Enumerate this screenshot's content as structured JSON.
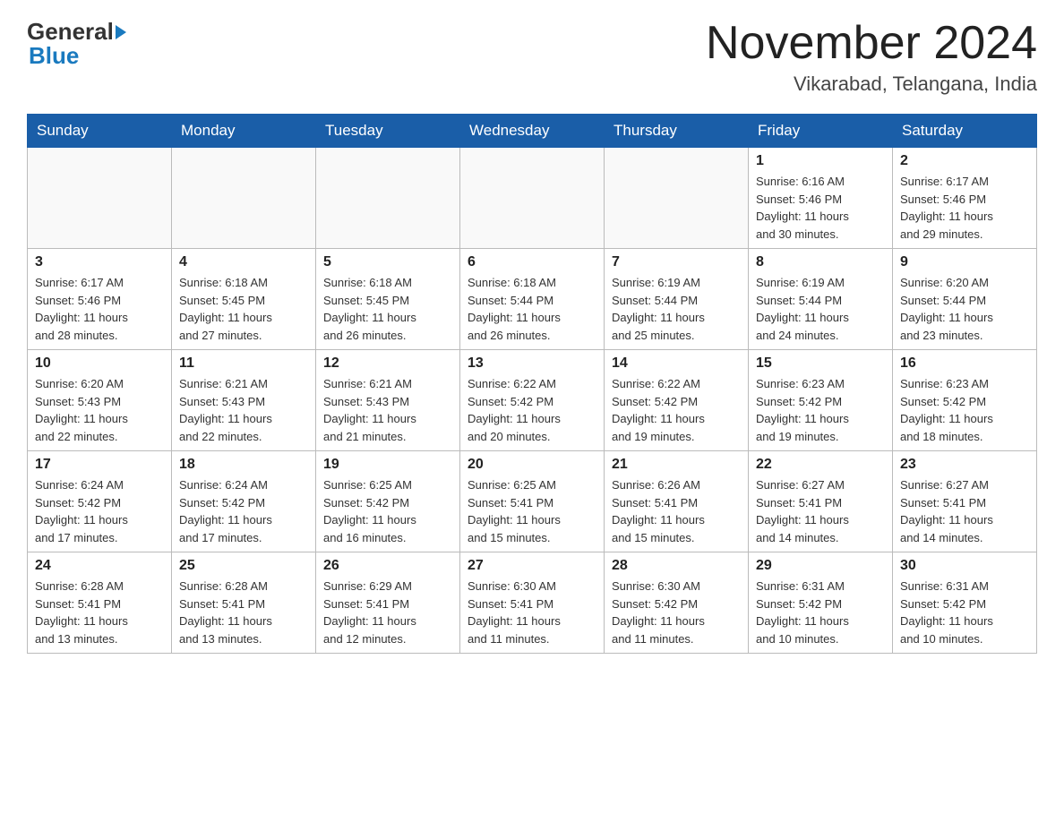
{
  "header": {
    "logo_general": "General",
    "logo_blue": "Blue",
    "month_title": "November 2024",
    "location": "Vikarabad, Telangana, India"
  },
  "weekdays": [
    "Sunday",
    "Monday",
    "Tuesday",
    "Wednesday",
    "Thursday",
    "Friday",
    "Saturday"
  ],
  "weeks": [
    [
      {
        "day": "",
        "info": ""
      },
      {
        "day": "",
        "info": ""
      },
      {
        "day": "",
        "info": ""
      },
      {
        "day": "",
        "info": ""
      },
      {
        "day": "",
        "info": ""
      },
      {
        "day": "1",
        "info": "Sunrise: 6:16 AM\nSunset: 5:46 PM\nDaylight: 11 hours\nand 30 minutes."
      },
      {
        "day": "2",
        "info": "Sunrise: 6:17 AM\nSunset: 5:46 PM\nDaylight: 11 hours\nand 29 minutes."
      }
    ],
    [
      {
        "day": "3",
        "info": "Sunrise: 6:17 AM\nSunset: 5:46 PM\nDaylight: 11 hours\nand 28 minutes."
      },
      {
        "day": "4",
        "info": "Sunrise: 6:18 AM\nSunset: 5:45 PM\nDaylight: 11 hours\nand 27 minutes."
      },
      {
        "day": "5",
        "info": "Sunrise: 6:18 AM\nSunset: 5:45 PM\nDaylight: 11 hours\nand 26 minutes."
      },
      {
        "day": "6",
        "info": "Sunrise: 6:18 AM\nSunset: 5:44 PM\nDaylight: 11 hours\nand 26 minutes."
      },
      {
        "day": "7",
        "info": "Sunrise: 6:19 AM\nSunset: 5:44 PM\nDaylight: 11 hours\nand 25 minutes."
      },
      {
        "day": "8",
        "info": "Sunrise: 6:19 AM\nSunset: 5:44 PM\nDaylight: 11 hours\nand 24 minutes."
      },
      {
        "day": "9",
        "info": "Sunrise: 6:20 AM\nSunset: 5:44 PM\nDaylight: 11 hours\nand 23 minutes."
      }
    ],
    [
      {
        "day": "10",
        "info": "Sunrise: 6:20 AM\nSunset: 5:43 PM\nDaylight: 11 hours\nand 22 minutes."
      },
      {
        "day": "11",
        "info": "Sunrise: 6:21 AM\nSunset: 5:43 PM\nDaylight: 11 hours\nand 22 minutes."
      },
      {
        "day": "12",
        "info": "Sunrise: 6:21 AM\nSunset: 5:43 PM\nDaylight: 11 hours\nand 21 minutes."
      },
      {
        "day": "13",
        "info": "Sunrise: 6:22 AM\nSunset: 5:42 PM\nDaylight: 11 hours\nand 20 minutes."
      },
      {
        "day": "14",
        "info": "Sunrise: 6:22 AM\nSunset: 5:42 PM\nDaylight: 11 hours\nand 19 minutes."
      },
      {
        "day": "15",
        "info": "Sunrise: 6:23 AM\nSunset: 5:42 PM\nDaylight: 11 hours\nand 19 minutes."
      },
      {
        "day": "16",
        "info": "Sunrise: 6:23 AM\nSunset: 5:42 PM\nDaylight: 11 hours\nand 18 minutes."
      }
    ],
    [
      {
        "day": "17",
        "info": "Sunrise: 6:24 AM\nSunset: 5:42 PM\nDaylight: 11 hours\nand 17 minutes."
      },
      {
        "day": "18",
        "info": "Sunrise: 6:24 AM\nSunset: 5:42 PM\nDaylight: 11 hours\nand 17 minutes."
      },
      {
        "day": "19",
        "info": "Sunrise: 6:25 AM\nSunset: 5:42 PM\nDaylight: 11 hours\nand 16 minutes."
      },
      {
        "day": "20",
        "info": "Sunrise: 6:25 AM\nSunset: 5:41 PM\nDaylight: 11 hours\nand 15 minutes."
      },
      {
        "day": "21",
        "info": "Sunrise: 6:26 AM\nSunset: 5:41 PM\nDaylight: 11 hours\nand 15 minutes."
      },
      {
        "day": "22",
        "info": "Sunrise: 6:27 AM\nSunset: 5:41 PM\nDaylight: 11 hours\nand 14 minutes."
      },
      {
        "day": "23",
        "info": "Sunrise: 6:27 AM\nSunset: 5:41 PM\nDaylight: 11 hours\nand 14 minutes."
      }
    ],
    [
      {
        "day": "24",
        "info": "Sunrise: 6:28 AM\nSunset: 5:41 PM\nDaylight: 11 hours\nand 13 minutes."
      },
      {
        "day": "25",
        "info": "Sunrise: 6:28 AM\nSunset: 5:41 PM\nDaylight: 11 hours\nand 13 minutes."
      },
      {
        "day": "26",
        "info": "Sunrise: 6:29 AM\nSunset: 5:41 PM\nDaylight: 11 hours\nand 12 minutes."
      },
      {
        "day": "27",
        "info": "Sunrise: 6:30 AM\nSunset: 5:41 PM\nDaylight: 11 hours\nand 11 minutes."
      },
      {
        "day": "28",
        "info": "Sunrise: 6:30 AM\nSunset: 5:42 PM\nDaylight: 11 hours\nand 11 minutes."
      },
      {
        "day": "29",
        "info": "Sunrise: 6:31 AM\nSunset: 5:42 PM\nDaylight: 11 hours\nand 10 minutes."
      },
      {
        "day": "30",
        "info": "Sunrise: 6:31 AM\nSunset: 5:42 PM\nDaylight: 11 hours\nand 10 minutes."
      }
    ]
  ]
}
